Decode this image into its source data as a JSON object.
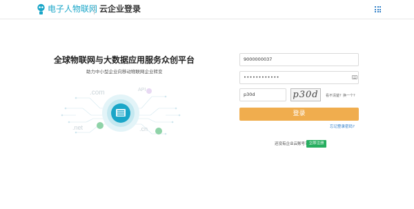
{
  "header": {
    "brand": "电子人物联网",
    "subtitle": "云企业登录",
    "logo_icon": "robot-icon",
    "apps_icon": "grid-icon"
  },
  "promo": {
    "headline": "全球物联网与大数据应用服务众创平台",
    "tagline": "助力中小型企业向移动物联网企业转变",
    "tags": [
      ".com",
      "API",
      ".net",
      ".cn"
    ]
  },
  "form": {
    "username": "9000000037",
    "password": "••••••••••••",
    "captcha_value": "p30d",
    "captcha_image_text": "p30d",
    "refresh_text": "看不清楚？换一个?",
    "login_label": "登录",
    "forgot_label": "忘记登录密码?",
    "no_account_text": "还没有企业云账号？",
    "register_label": "立即注册"
  },
  "colors": {
    "brand": "#1aa6c8",
    "login_button": "#f0ad4e",
    "register_button": "#27ae60",
    "link": "#2a7ac7"
  }
}
